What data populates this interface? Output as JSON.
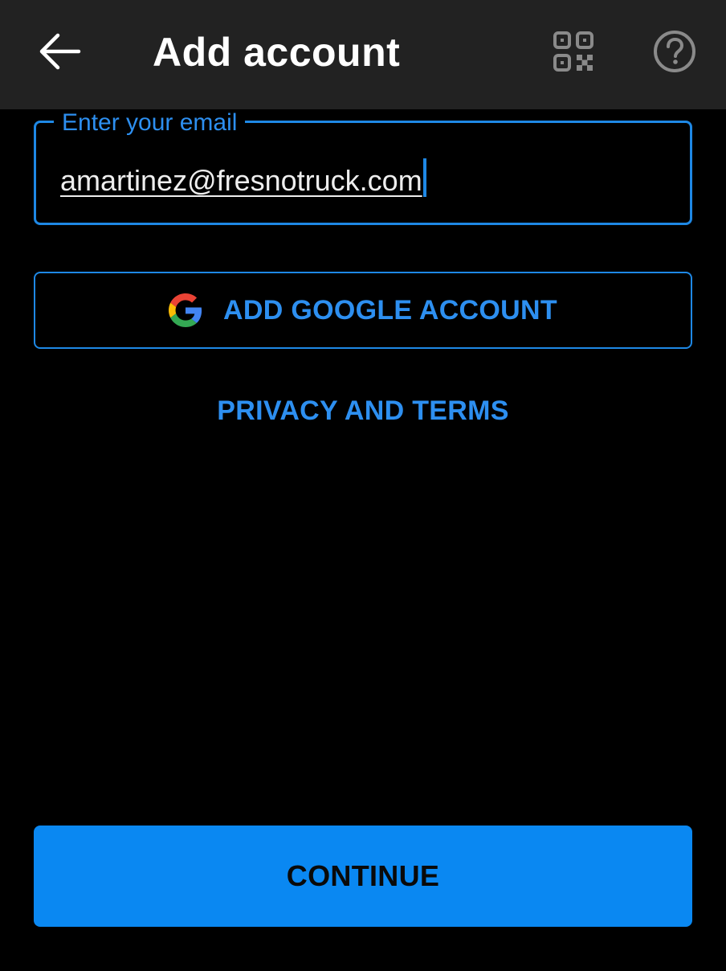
{
  "appbar": {
    "title": "Add account",
    "back_icon": "arrow-left-icon",
    "qr_icon": "qr-code-icon",
    "help_icon": "help-circle-icon"
  },
  "email": {
    "label": "Enter your email",
    "value": "amartinez@fresnotruck.com"
  },
  "google_button": {
    "label": "ADD GOOGLE ACCOUNT",
    "icon": "google-logo-icon"
  },
  "privacy_link": "PRIVACY AND TERMS",
  "continue_button": "CONTINUE",
  "colors": {
    "background": "#000000",
    "appbar": "#222222",
    "accent": "#1e88e5",
    "primary_button": "#0a88f2"
  }
}
